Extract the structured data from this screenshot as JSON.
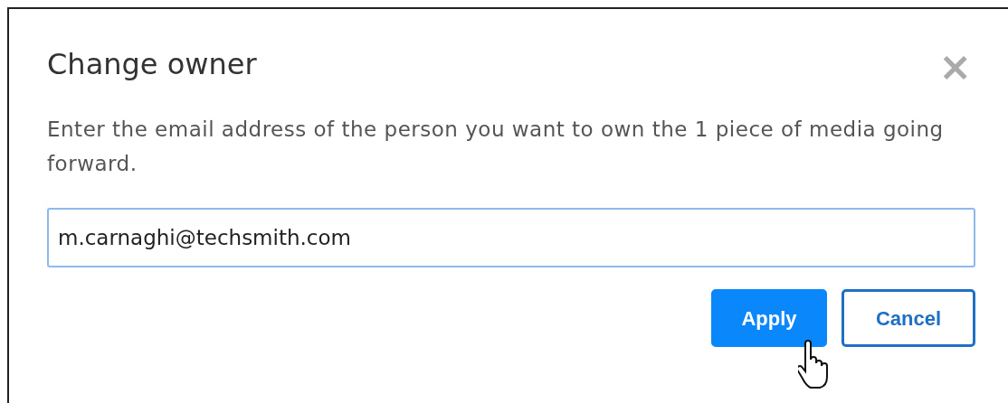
{
  "dialog": {
    "title": "Change owner",
    "close": "×",
    "description": "Enter the email address of the person you want to own the 1 piece of media going forward.",
    "email_field": {
      "value": "m.carnaghi@techsmith.com"
    },
    "buttons": [
      {
        "label": "Apply",
        "kind": "primary"
      },
      {
        "label": "Cancel",
        "kind": "secondary"
      }
    ]
  }
}
